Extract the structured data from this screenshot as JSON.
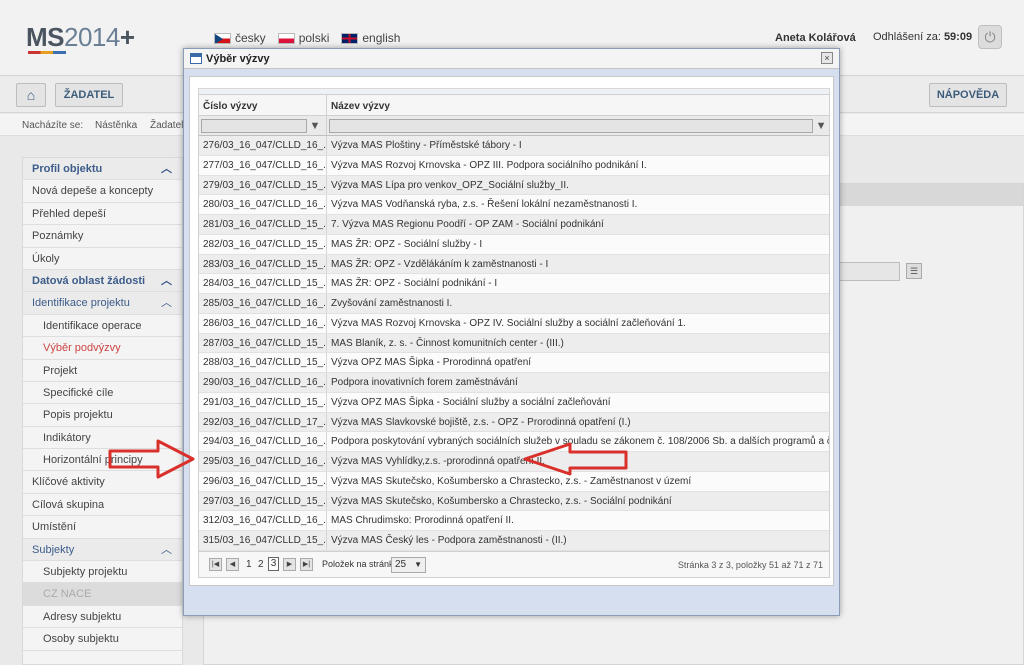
{
  "header": {
    "logo_main": "MS",
    "logo_year": "2014",
    "logo_plus": "+",
    "languages": [
      {
        "label": "česky",
        "flag": "flag-cz-icon"
      },
      {
        "label": "polski",
        "flag": "flag-pl-icon"
      },
      {
        "label": "english",
        "flag": "flag-en-icon"
      }
    ],
    "user_name": "Aneta Kolářová",
    "logout_label": "Odhlášení za:",
    "logout_time": "59:09"
  },
  "nav": {
    "home_icon": "home-icon",
    "zadatel_label": "ŽADATEL",
    "help_label": "NÁPOVĚDA"
  },
  "breadcrumb": {
    "prefix": "Nacházíte se:",
    "items": [
      "Nástěnka",
      "Žadatel"
    ]
  },
  "sidebar": {
    "items": [
      {
        "label": "Profil objektu",
        "type": "head"
      },
      {
        "label": "Nová depeše a koncepty",
        "type": "item"
      },
      {
        "label": "Přehled depeší",
        "type": "item"
      },
      {
        "label": "Poznámky",
        "type": "item"
      },
      {
        "label": "Úkoly",
        "type": "item"
      },
      {
        "label": "Datová oblast žádosti",
        "type": "head"
      },
      {
        "label": "Identifikace projektu",
        "type": "subhead"
      },
      {
        "label": "Identifikace operace",
        "type": "sub"
      },
      {
        "label": "Výběr podvýzvy",
        "type": "sub-active"
      },
      {
        "label": "Projekt",
        "type": "sub"
      },
      {
        "label": "Specifické cíle",
        "type": "sub"
      },
      {
        "label": "Popis projektu",
        "type": "sub"
      },
      {
        "label": "Indikátory",
        "type": "sub"
      },
      {
        "label": "Horizontální principy",
        "type": "sub"
      },
      {
        "label": "Klíčové aktivity",
        "type": "item"
      },
      {
        "label": "Cílová skupina",
        "type": "item"
      },
      {
        "label": "Umístění",
        "type": "item"
      },
      {
        "label": "Subjekty",
        "type": "subhead"
      },
      {
        "label": "Subjekty projektu",
        "type": "sub"
      },
      {
        "label": "CZ NACE",
        "type": "sub-disabled"
      },
      {
        "label": "Adresy subjektu",
        "type": "sub"
      },
      {
        "label": "Osoby subjektu",
        "type": "sub"
      }
    ]
  },
  "modal": {
    "title": "Výběr výzvy",
    "close_symbol": "×",
    "columns": [
      "Číslo výzvy",
      "Název výzvy"
    ],
    "rows": [
      [
        "276/03_16_047/CLLD_16_...",
        "Výzva MAS Ploštiny - Příměstské tábory - I"
      ],
      [
        "277/03_16_047/CLLD_16_...",
        "Výzva MAS Rozvoj Krnovska - OPZ III. Podpora sociálního podnikání I."
      ],
      [
        "279/03_16_047/CLLD_15_...",
        "Výzva MAS Lípa pro venkov_OPZ_Sociální služby_II."
      ],
      [
        "280/03_16_047/CLLD_16_...",
        "Výzva MAS Vodňanská ryba, z.s. - Řešení lokální nezaměstnanosti I."
      ],
      [
        "281/03_16_047/CLLD_15_...",
        "7. Výzva MAS Regionu Poodří - OP ZAM - Sociální podnikání"
      ],
      [
        "282/03_16_047/CLLD_15_...",
        "MAS ŽR: OPZ - Sociální služby - I"
      ],
      [
        "283/03_16_047/CLLD_15_...",
        "MAS ŽR: OPZ - Vzdělákáním k zaměstnanosti - I"
      ],
      [
        "284/03_16_047/CLLD_15_...",
        "MAS ŽR: OPZ - Sociální podnikání - I"
      ],
      [
        "285/03_16_047/CLLD_16_...",
        "Zvyšování zaměstnanosti I."
      ],
      [
        "286/03_16_047/CLLD_16_...",
        "Výzva MAS Rozvoj Krnovska - OPZ IV. Sociální služby a sociální začleňování 1."
      ],
      [
        "287/03_16_047/CLLD_15_...",
        "MAS Blaník, z. s. - Činnost komunitních center - (III.)"
      ],
      [
        "288/03_16_047/CLLD_15_...",
        "Výzva OPZ MAS Šipka - Prorodinná opatření"
      ],
      [
        "290/03_16_047/CLLD_16_...",
        "Podpora inovativních forem zaměstnávání"
      ],
      [
        "291/03_16_047/CLLD_15_...",
        "Výzva OPZ MAS Šipka - Sociální služby a sociální začleňování"
      ],
      [
        "292/03_16_047/CLLD_17_...",
        "Výzva MAS Slavkovské bojiště, z.s. - OPZ - Prorodinná opatření (I.)"
      ],
      [
        "294/03_16_047/CLLD_16_...",
        "Podpora poskytování vybraných sociálních služeb v souladu se zákonem č. 108/2006 Sb. a dalších programů a činností v..."
      ],
      [
        "295/03_16_047/CLLD_16_...",
        "Výzva MAS Vyhlídky,z.s. -prorodinná opatření II."
      ],
      [
        "296/03_16_047/CLLD_15_...",
        "Výzva MAS Skutečsko, Košumbersko a Chrastecko, z.s. - Zaměstnanost v území"
      ],
      [
        "297/03_16_047/CLLD_15_...",
        "Výzva MAS Skutečsko, Košumbersko a Chrastecko, z.s. - Sociální podnikání"
      ],
      [
        "312/03_16_047/CLLD_16_...",
        "MAS Chrudimsko: Prorodinná opatření II."
      ],
      [
        "315/03_16_047/CLLD_15_...",
        "Výzva MAS Český les - Podpora zaměstnanosti - (II.)"
      ]
    ],
    "pager": {
      "first": "|◀",
      "prev": "◀",
      "page1": "1",
      "page2": "2",
      "page3": "3",
      "next": "▶",
      "last": "▶|",
      "per_page_label": "Položek na stránku",
      "per_page": "25",
      "info": "Stránka 3 z 3, položky 51 až 71 z 71"
    }
  },
  "colors": {
    "accent": "#3c5c8a",
    "arrow": "#d9302b",
    "modal_bg": "#d5dff0"
  }
}
